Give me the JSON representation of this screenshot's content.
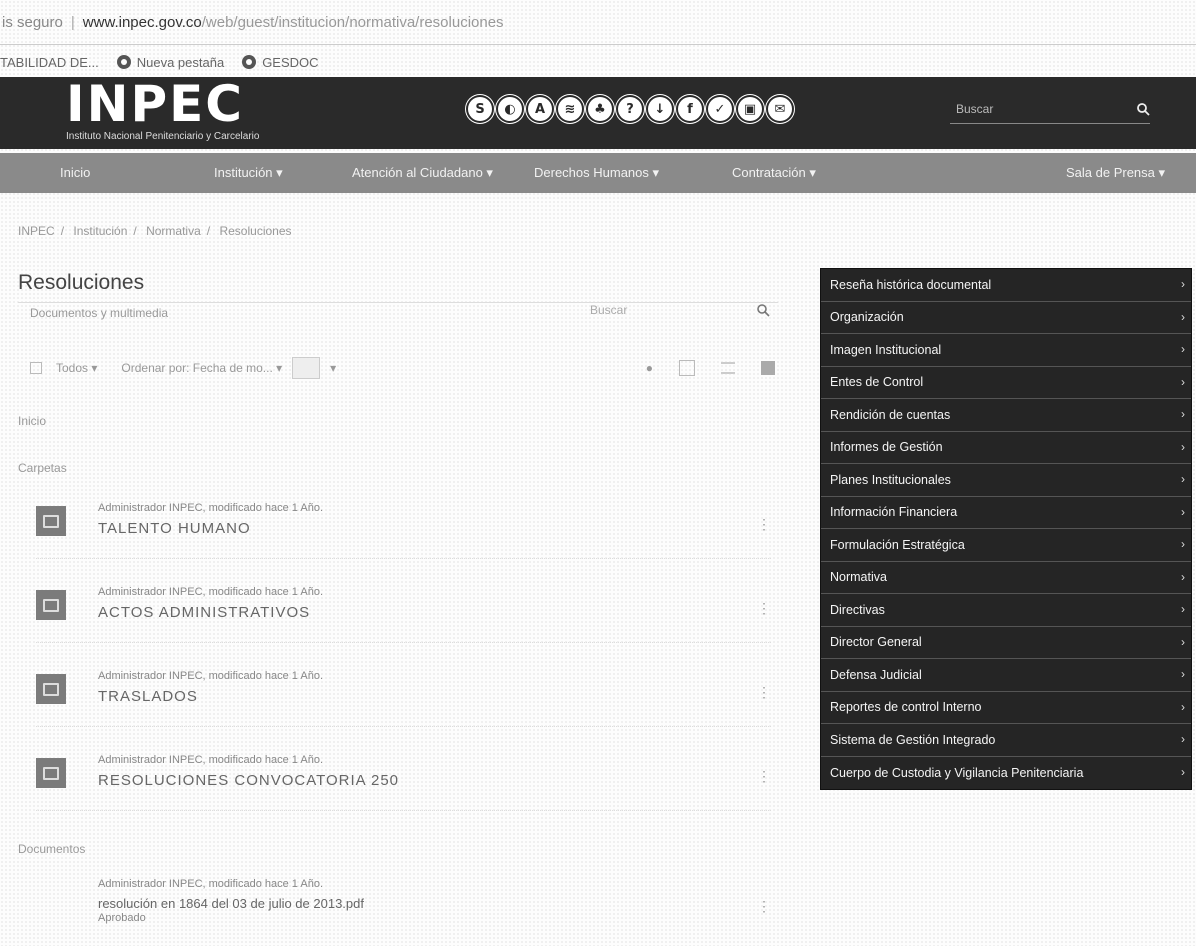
{
  "browser": {
    "security": "is seguro",
    "url_host": "www.inpec.gov.co",
    "url_path": "/web/guest/institucion/normativa/resoluciones",
    "bookmarks": [
      "TABILIDAD DE...",
      "Nueva pestaña",
      "GESDOC"
    ]
  },
  "header": {
    "logo": "INPEC",
    "tagline": "Instituto Nacional Penitenciario y Carcelario",
    "social_icons": [
      "S",
      "◐",
      "A",
      "≋",
      "♣",
      "?",
      "↓",
      "f",
      "✓",
      "▣",
      "✉"
    ],
    "search_placeholder": "Buscar"
  },
  "nav": {
    "items": [
      "Inicio",
      "Institución ▾",
      "Atención al Ciudadano ▾",
      "Derechos Humanos ▾",
      "Contratación ▾",
      "Sala de Prensa ▾"
    ]
  },
  "breadcrumb": [
    "INPEC",
    "Institución",
    "Normativa",
    "Resoluciones"
  ],
  "main": {
    "title": "Resoluciones",
    "docs_label": "Documentos y multimedia",
    "search_placeholder": "Buscar",
    "filter_all": "Todos ▾",
    "filter_order": "Ordenar por: Fecha de mo... ▾",
    "view_label": "Inicio",
    "folders_label": "Carpetas",
    "documents_label": "Documentos",
    "folders": [
      {
        "meta": "Administrador INPEC, modificado hace 1 Año.",
        "name": "TALENTO HUMANO"
      },
      {
        "meta": "Administrador INPEC, modificado hace 1 Año.",
        "name": "ACTOS ADMINISTRATIVOS"
      },
      {
        "meta": "Administrador INPEC, modificado hace 1 Año.",
        "name": "TRASLADOS"
      },
      {
        "meta": "Administrador INPEC, modificado hace 1 Año.",
        "name": "RESOLUCIONES CONVOCATORIA 250"
      }
    ],
    "documents": [
      {
        "meta": "Administrador INPEC, modificado hace 1 Año.",
        "name": "resolución en 1864 del 03 de julio de 2013.pdf",
        "status": "Aprobado"
      }
    ]
  },
  "sidebar": {
    "items": [
      "Reseña histórica documental",
      "Organización",
      "Imagen Institucional",
      "Entes de Control",
      "Rendición de cuentas",
      "Informes de Gestión",
      "Planes Institucionales",
      "Información Financiera",
      "Formulación Estratégica",
      "Normativa",
      "Directivas",
      "Director General",
      "Defensa Judicial",
      "Reportes de control Interno",
      "Sistema de Gestión Integrado",
      "Cuerpo de Custodia y Vigilancia Penitenciaria"
    ]
  }
}
